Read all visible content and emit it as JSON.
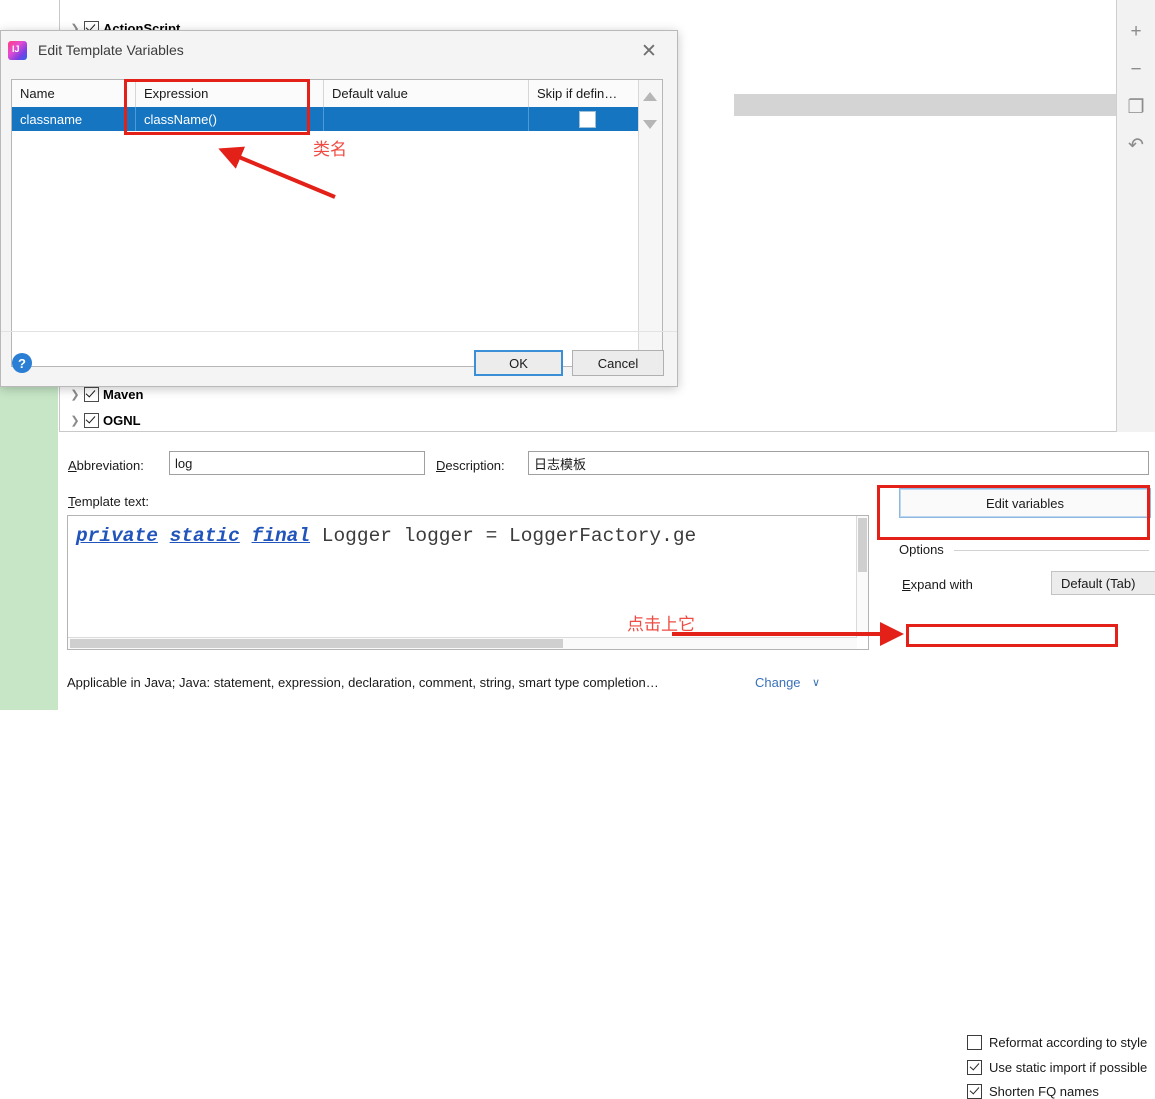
{
  "background": {
    "tree_items": [
      {
        "label": "ActionScript",
        "checked": true,
        "expandable": true
      },
      {
        "label": "Maven",
        "checked": true,
        "expandable": true
      },
      {
        "label": "OGNL",
        "checked": true,
        "expandable": true
      }
    ],
    "twisty_glyph": "❯",
    "toolbar": [
      {
        "name": "add-icon",
        "glyph": "+"
      },
      {
        "name": "remove-icon",
        "glyph": "−"
      },
      {
        "name": "copy-icon",
        "glyph": "❐"
      },
      {
        "name": "revert-icon",
        "glyph": "↶"
      }
    ]
  },
  "form": {
    "abbreviation_label": "Abbreviation:",
    "abbreviation_value": "log",
    "description_label": "Description:",
    "description_value": "日志模板",
    "template_text_label": "Template text:",
    "template_keywords": [
      "private",
      "static",
      "final"
    ],
    "template_rest": " Logger logger = LoggerFactory.ge",
    "edit_variables_label": "Edit variables",
    "options_label": "Options",
    "expand_with_label": "Expand with",
    "expand_with_value": "Default (Tab)",
    "chevron_down": "∨",
    "checkboxes": [
      {
        "label": "Reformat according to style",
        "checked": false
      },
      {
        "label": "Use static import if possible",
        "checked": true
      },
      {
        "label": "Shorten FQ names",
        "checked": true
      }
    ],
    "applicable_text": "Applicable in Java; Java: statement, expression, declaration, comment, string, smart type completion…",
    "change_link": "Change",
    "change_chevron": "∨"
  },
  "dialog": {
    "title": "Edit Template Variables",
    "close_glyph": "✕",
    "icon_name": "intellij-idea-icon",
    "columns": [
      "Name",
      "Expression",
      "Default value",
      "Skip if defin…"
    ],
    "rows": [
      {
        "name": "classname",
        "expression": "className()",
        "default_value": "",
        "skip_if_defined": false
      }
    ],
    "scroll_up_glyph": "▲",
    "scroll_down_glyph": "▼",
    "help_glyph": "?",
    "ok_label": "OK",
    "cancel_label": "Cancel"
  },
  "annotations": {
    "classname_note": "类名",
    "click_note": "点击上它",
    "highlight_color": "#e32119",
    "note_color": "#ef4b43"
  }
}
